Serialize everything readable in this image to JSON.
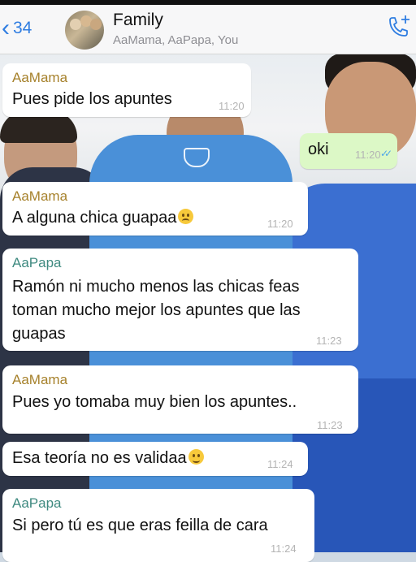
{
  "header": {
    "back_count": "34",
    "title": "Family",
    "subtitle": "AaMama, AaPapa, You"
  },
  "messages": [
    {
      "sender": "AaMama",
      "lines": [
        "Pues pide los apuntes"
      ],
      "time": "11:20"
    },
    {
      "sender": "",
      "lines": [
        "oki"
      ],
      "time": "11:20",
      "outgoing": true,
      "status": "read"
    },
    {
      "sender": "AaMama",
      "lines": [
        "A alguna chica guapaa"
      ],
      "emoji": "sad-face-emoji",
      "time": "11:20"
    },
    {
      "sender": "AaPapa",
      "lines": [
        "Ramón ni mucho menos las chicas feas",
        "toman mucho mejor los apuntes que las",
        "guapas"
      ],
      "time": "11:23"
    },
    {
      "sender": "AaMama",
      "lines": [
        "Pues yo tomaba muy bien los apuntes.."
      ],
      "time": "11:23"
    },
    {
      "sender": "",
      "lines": [
        "Esa teoría no es validaa"
      ],
      "emoji": "winking-face-emoji",
      "time": "11:24"
    },
    {
      "sender": "AaPapa",
      "lines": [
        "Si pero tú es que eras feilla de cara"
      ],
      "time": "11:24"
    }
  ],
  "colors": {
    "accent": "#2f7de1",
    "incoming_bubble": "#ffffff",
    "outgoing_bubble": "#dcf8c6",
    "sender_mama": "#a6812b",
    "sender_papa": "#3f8a80",
    "read_ticks": "#4fa6e8"
  }
}
